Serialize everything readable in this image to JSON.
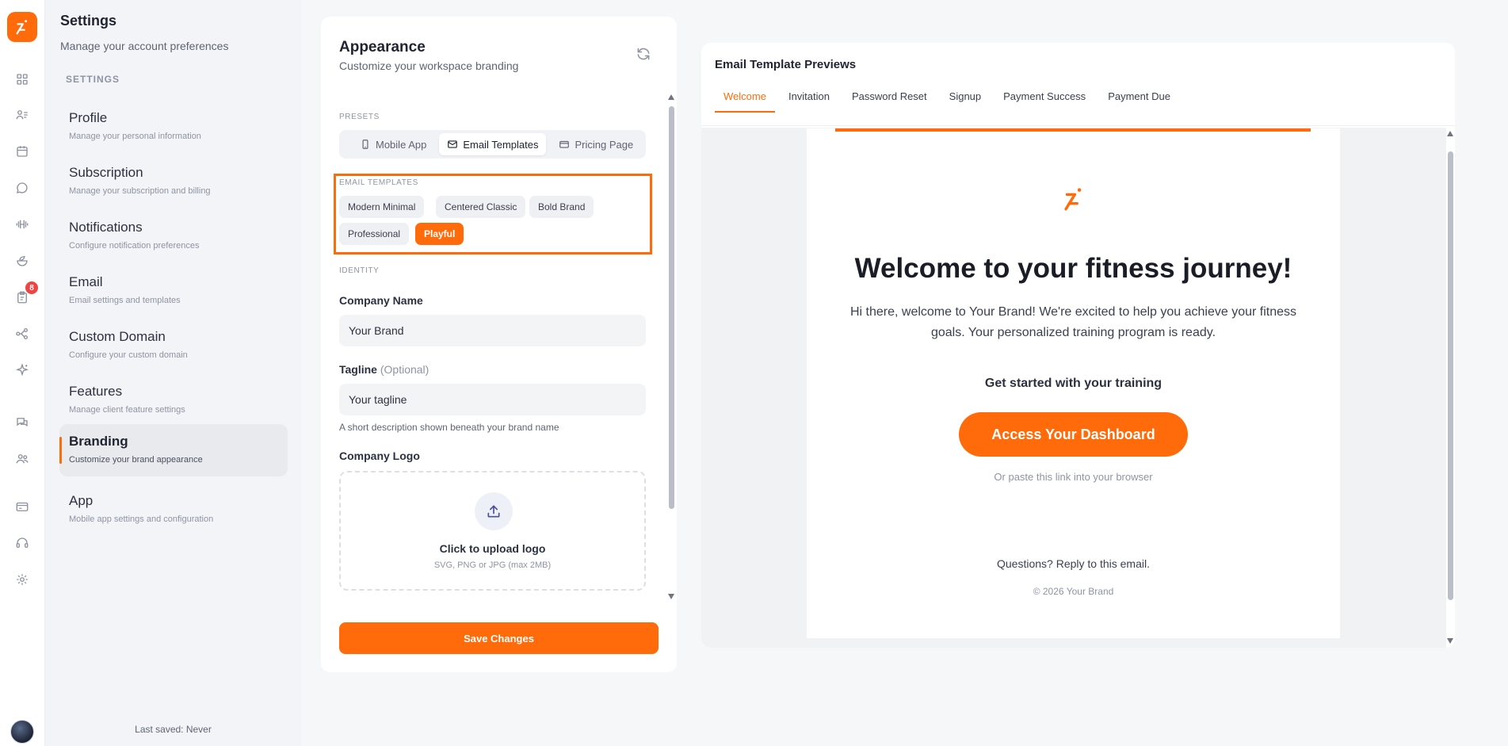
{
  "settings": {
    "title": "Settings",
    "subtitle": "Manage your account preferences",
    "section_label": "SETTINGS",
    "items": [
      {
        "label": "Profile",
        "desc": "Manage your personal information"
      },
      {
        "label": "Subscription",
        "desc": "Manage your subscription and billing"
      },
      {
        "label": "Notifications",
        "desc": "Configure notification preferences"
      },
      {
        "label": "Email",
        "desc": "Email settings and templates"
      },
      {
        "label": "Custom Domain",
        "desc": "Configure your custom domain"
      },
      {
        "label": "Features",
        "desc": "Manage client feature settings"
      },
      {
        "label": "Branding",
        "desc": "Customize your brand appearance"
      },
      {
        "label": "App",
        "desc": "Mobile app settings and configuration"
      }
    ],
    "active_item": "Branding",
    "last_saved": "Last saved: Never"
  },
  "rail": {
    "badge_count": "8",
    "icons": [
      "grid-icon",
      "clients-list-icon",
      "calendar-icon",
      "chat-icon",
      "dumbbell-icon",
      "nutrition-bowl-icon",
      "clipboard-icon",
      "workflow-icon",
      "sparkle-icon",
      "messages-icon",
      "team-icon",
      "card-icon",
      "headset-icon",
      "gear-icon"
    ]
  },
  "appearance": {
    "title": "Appearance",
    "subtitle": "Customize your workspace branding",
    "presets_label": "PRESETS",
    "presets": [
      {
        "label": "Mobile App",
        "icon": "phone-icon"
      },
      {
        "label": "Email Templates",
        "icon": "mail-icon"
      },
      {
        "label": "Pricing Page",
        "icon": "card-icon"
      }
    ],
    "active_preset": "Email Templates",
    "templates_label": "EMAIL TEMPLATES",
    "templates": [
      "Modern Minimal",
      "Centered Classic",
      "Bold Brand",
      "Professional",
      "Playful"
    ],
    "active_template": "Playful",
    "identity_label": "IDENTITY",
    "company_name_label": "Company Name",
    "company_name_value": "Your Brand",
    "tagline_label": "Tagline",
    "tagline_optional": "(Optional)",
    "tagline_value": "Your tagline",
    "tagline_hint": "A short description shown beneath your brand name",
    "logo_label": "Company Logo",
    "upload_title": "Click to upload logo",
    "upload_hint": "SVG, PNG or JPG (max 2MB)",
    "save_label": "Save Changes"
  },
  "previews": {
    "title": "Email Template Previews",
    "tabs": [
      "Welcome",
      "Invitation",
      "Password Reset",
      "Signup",
      "Payment Success",
      "Payment Due"
    ],
    "active_tab": "Welcome",
    "email": {
      "heading": "Welcome to your fitness journey!",
      "body": "Hi there, welcome to Your Brand! We're excited to help you achieve your fitness goals. Your personalized training program is ready.",
      "cta_lead": "Get started with your training",
      "cta_label": "Access Your Dashboard",
      "alt_link": "Or paste this link into your browser",
      "questions": "Questions? Reply to this email.",
      "copyright": "© 2026 Your Brand"
    }
  },
  "colors": {
    "accent": "#ff6b0a",
    "badge": "#ef4444",
    "sidebar_bg": "#f3f4f7",
    "panel_bg": "#ffffff"
  }
}
